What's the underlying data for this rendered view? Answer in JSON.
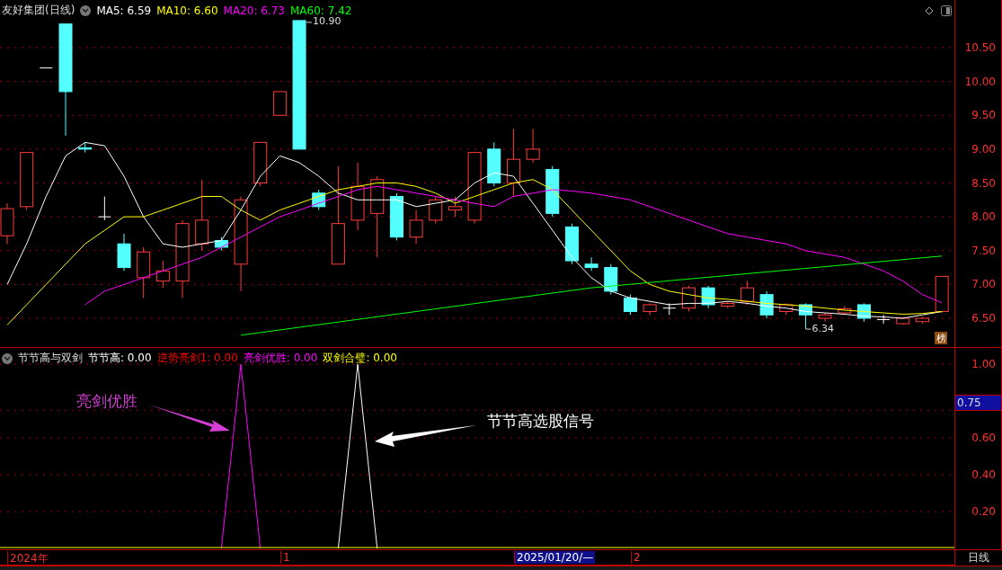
{
  "main_chart": {
    "title": "友好集团(日线)",
    "legend": [
      {
        "label": "MA5: 6.59",
        "color": "#ffffff"
      },
      {
        "label": "MA10: 6.60",
        "color": "#ffff00"
      },
      {
        "label": "MA20: 6.73",
        "color": "#ff00ff"
      },
      {
        "label": "MA60: 7.42",
        "color": "#00ff00"
      }
    ],
    "high_label": "10.90",
    "low_label": "6.34",
    "badge": "榜",
    "y_ticks": [
      "10.50",
      "10.00",
      "9.50",
      "9.00",
      "8.50",
      "8.00",
      "7.50",
      "7.00",
      "6.50"
    ]
  },
  "indicator": {
    "title": "节节高与双剑",
    "legend": [
      {
        "label": "节节高: 0.00",
        "color": "#ffffff"
      },
      {
        "label": "逆势亮剑1: 0.00",
        "color": "#ff0000"
      },
      {
        "label": "亮剑优胜: 0.00",
        "color": "#ff00ff"
      },
      {
        "label": "双剑合璧: 0.00",
        "color": "#ffff00"
      }
    ],
    "annotations": [
      {
        "text": "亮剑优胜",
        "color": "#d63fd6"
      },
      {
        "text": "节节高选股信号",
        "color": "#ffffff"
      }
    ],
    "cursor_value": "0.75",
    "y_ticks": [
      "1.00",
      "0.60",
      "0.40",
      "0.20"
    ]
  },
  "date_axis": [
    {
      "label": "2024年",
      "highlighted": false
    },
    {
      "label": "1",
      "highlighted": false
    },
    {
      "label": "2025/01/20/—",
      "highlighted": true
    },
    {
      "label": "2",
      "highlighted": false
    }
  ],
  "period_label": "日线"
}
